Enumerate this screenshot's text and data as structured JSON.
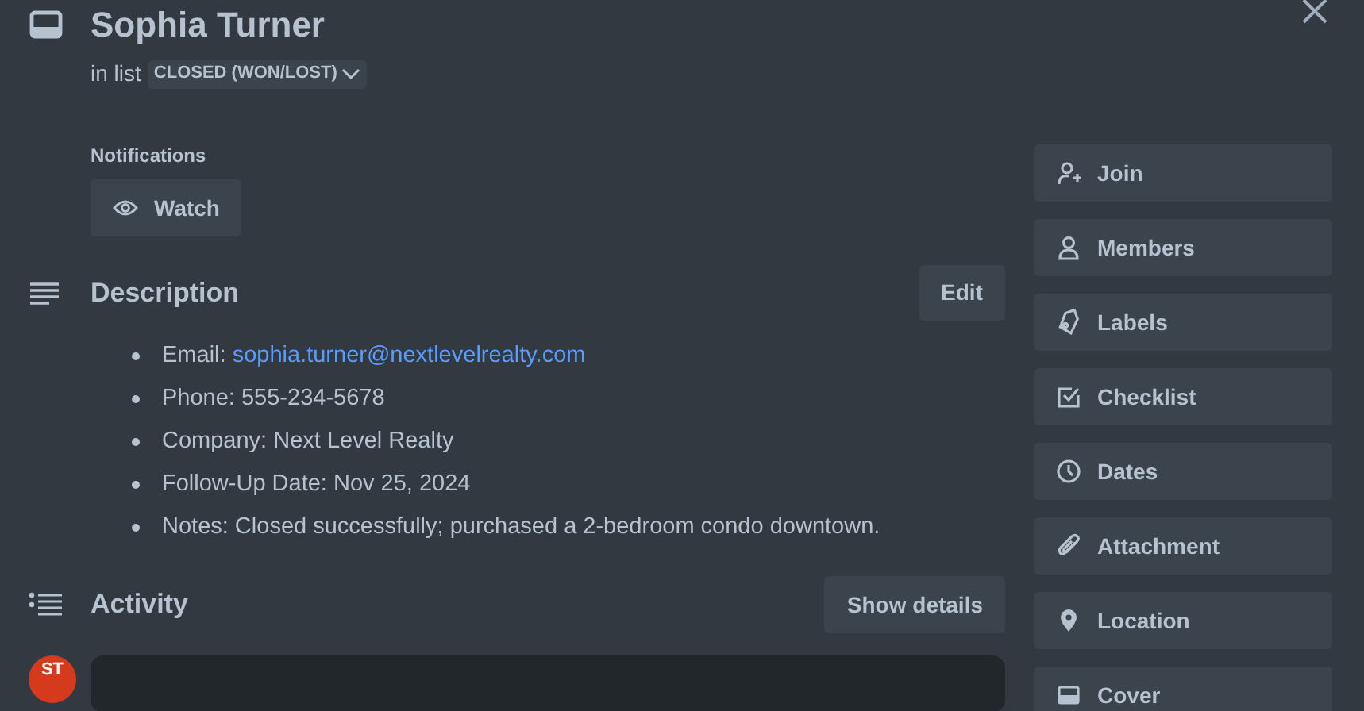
{
  "card": {
    "title": "Sophia Turner",
    "list_prefix": "in list",
    "list_name": "CLOSED (WON/LOST)"
  },
  "notifications": {
    "label": "Notifications",
    "button": "Watch"
  },
  "description": {
    "heading": "Description",
    "edit_button": "Edit",
    "items": [
      {
        "text": "Email:",
        "link": "sophia.turner@nextlevelrealty.com"
      },
      {
        "text": "Phone: 555-234-5678"
      },
      {
        "text": "Company: Next Level Realty"
      },
      {
        "text": "Follow-Up Date: Nov 25, 2024"
      },
      {
        "text": "Notes: Closed successfully; purchased a 2-bedroom condo downtown."
      }
    ]
  },
  "activity": {
    "heading": "Activity",
    "button": "Show details",
    "avatar": "ST"
  },
  "actions": [
    {
      "kind": "join",
      "label": "Join"
    },
    {
      "kind": "members",
      "label": "Members"
    },
    {
      "kind": "labels",
      "label": "Labels"
    },
    {
      "kind": "checklist",
      "label": "Checklist"
    },
    {
      "kind": "dates",
      "label": "Dates"
    },
    {
      "kind": "attachment",
      "label": "Attachment"
    },
    {
      "kind": "location",
      "label": "Location"
    },
    {
      "kind": "cover",
      "label": "Cover"
    }
  ]
}
